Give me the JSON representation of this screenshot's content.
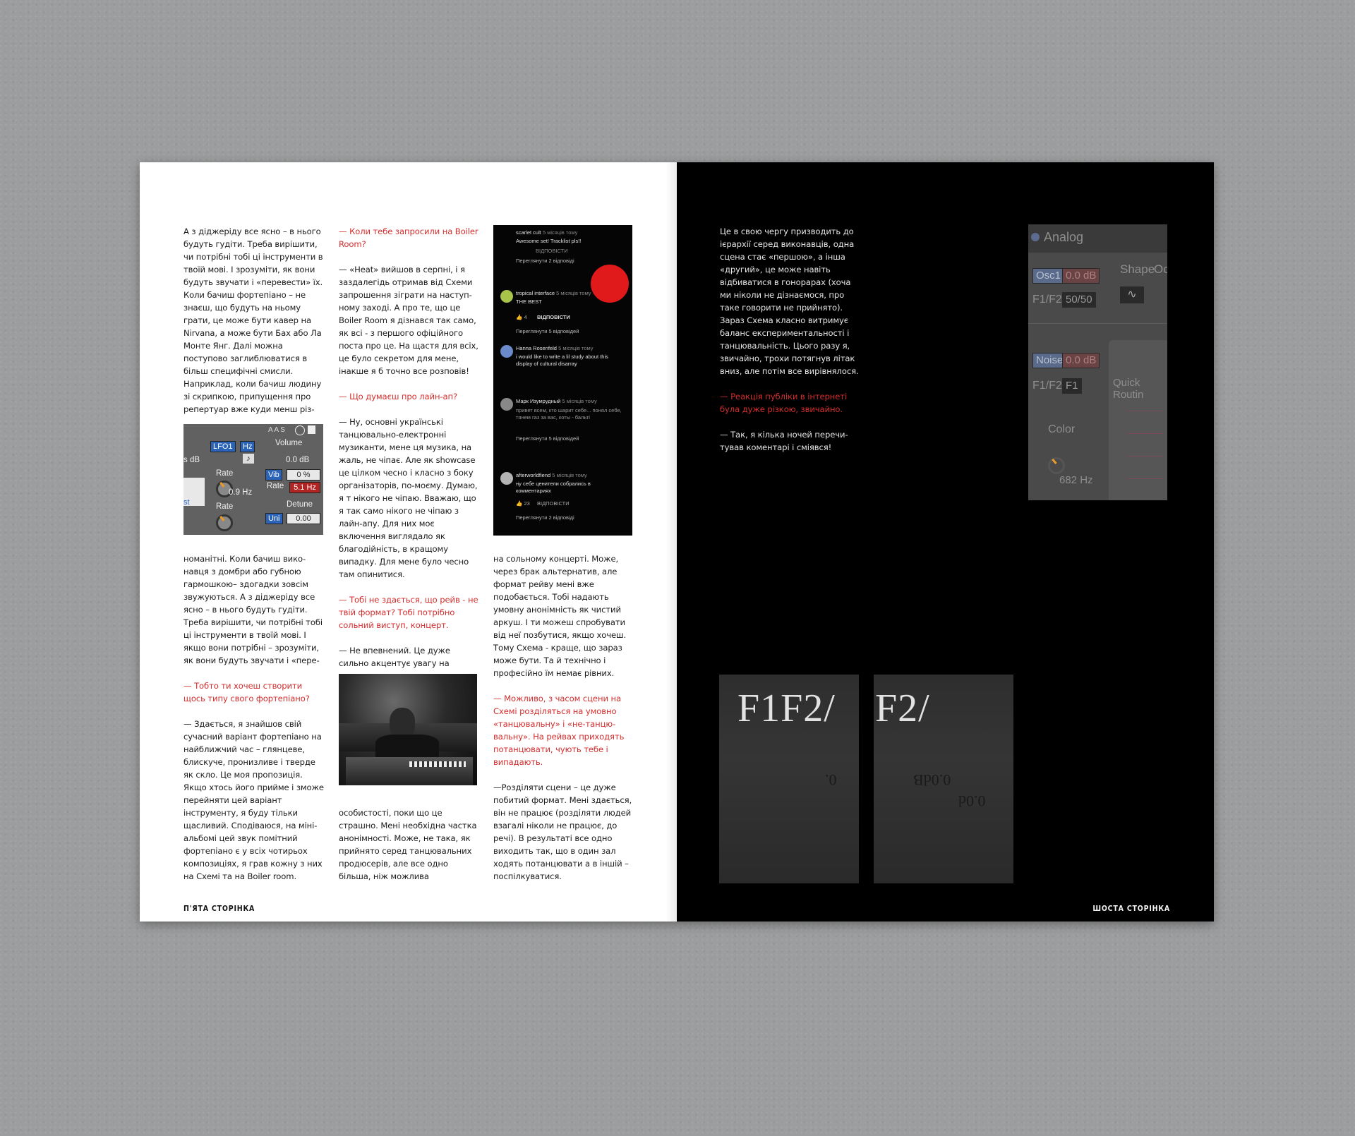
{
  "left_page": {
    "col1": {
      "top": [
        "А з діджеріду все ясно – в нього будуть гудіти. Треба вирі­шити, чи потрібні тобі ці інстру­менти в твоїй мові. І зрозуміти, як вони будуть звучати і «пе­ревести» їх. Коли бачиш фор­тепіано – не знаєш, що будуть на ньому грати, це може бути кавер на Nirvana, а може бути Бах або Ла Монте Янг.  Далі можна поступово заглиблюва­тися в більш специфічні смисли. Наприклад, коли бачиш людину зі скрипкою, припущення про репертуар вже куди менш різ-"
      ],
      "bottom_p1": "номанітні. Коли бачиш вико­навця з домбри або губною гармошкою– здогадки зовсім звужуються. А з діджеріду все ясно – в нього будуть гудіти. Треба вирішити, чи потрібні тобі ці інструменти в твоїй мові. І якщо вони потрібні – зрозуміти, як вони будуть звучати і «пере-",
      "question": "— Тобто ти хочеш створити щось типу свого  фортепіано?",
      "answer": "— Здається, я знайшов свій сучасний варіант фортепіано на найближчий час – глянцеве, блискуче, пронизливе і тверде як скло. Це моя пропозиція. Якщо хтось його прийме і зможе перейняти цей варіант інструменту, я буду тільки щасливий. Сподіваюся, на міні-альбомі цей звук помітний фортепіано є у всіх чотирьох композиціях, я грав кожну з них на Схемі та на Boiler room."
    },
    "col2": {
      "q1": "— Коли тебе запросили на Boiler Room?",
      "a1": "— «Heat» вийшов в серпні, і я заздалегідь отримав від Схеми запрошення зіграти на наступ­ному заході. А про те, що це Boiler Room я дізнався так само, як всі - з першого офіційного поста про це. На щастя для всіх, це було секретом для мене, інакше я б точно все розповів!",
      "q2": "— Що думаєш про лайн-ап?",
      "a2": "— Ну, основні українські танцювально-електронні музиканти, мене ця музика, на жаль, не чіпає. Але як showcase це цілком чесно і класно з боку організаторів, по-моєму. Думаю, я т нікого не чіпаю. Вважаю, що я так само нікого не чіпаю з лайн-апу. Для них моє включення виглядало як благодійність, в кращому випадку. Для мене було чесно там опинитися.",
      "q3": "— Тобі не здається, що рейв - не твій формат? Тобі потрібно сольний виступ, концерт.",
      "a3": "— Не впевнений. Це дуже сильно акцентує увагу на",
      "a3_cont": "особистості, поки що це страшно. Мені необхідна частка анонімності. Може, не така, як прийнято серед танцювальних продюсерів, але все одно більша, ніж можлива"
    },
    "col3": {
      "a_cont": "на сольному концерті.  Може, через брак альтернатив, але формат рейву мені вже подобається. Тобі надають умовну анонімність як чистий аркуш. І ти можеш спробувати від неї позбутися, якщо хочеш. Тому Схема - краще, що зараз може бути. Та й технічно і професійно їм немає рівних.",
      "q4": "— Можливо, з часом сцени на Схемі розділяться на умовно «танцювальну» і «не-танцю­вальну». На рейвах приходять потанцювати, чують тебе і випадають.",
      "a4": "—Розділяти сцени – це дуже побитий формат. Мені зда­ється, він не працює (розділяти людей взагалі ніколи не працює, до речі).  В результаті все одно виходить так, що в один зал ходять потанцювати а в іншій – поспілкуватися."
    },
    "folio": "П'ЯТА СТОРІНКА",
    "synth": {
      "lfo": "LFO1",
      "hz": "Hz",
      "volume": "Volume",
      "vol_val": "0.0 dB",
      "db": "s dB",
      "rate": "Rate",
      "rate_val": "0.9 Hz",
      "vib": "Vib",
      "vib_val": "0 %",
      "rate2": "Rate",
      "rate2_val": "5.1 Hz",
      "rate3": "Rate",
      "detune": "Detune",
      "uni": "Uni",
      "uni_val": "0.00",
      "st": "st",
      "header": "A A S"
    },
    "comments": [
      {
        "user": "scarlet cult",
        "time": "5 місяців тому",
        "text": "Awesome set! Tracklist pls!!",
        "reply": "ВІДПОВІСТИ",
        "more": "Переглянути 2 відповіді"
      },
      {
        "user": "tropical interface",
        "time": "5 місяців тому",
        "text": "THE BEST",
        "likes": "4",
        "reply": "ВІДПОВІСТИ",
        "more": "Переглянути 5 відповідей"
      },
      {
        "user": "Hanna Rosenfeld",
        "time": "5 місяців тому",
        "text": "i would like to write a lil study about this display of cultural disarray"
      },
      {
        "user": "Марк Изумрудный",
        "time": "5 місяців тому",
        "text": "привет всем, кто шарит себе... понял себе, тянем газ за вас, коты - бальті",
        "more": "Переглянути 5 відповідей"
      },
      {
        "user": "afterworldfiend",
        "time": "5 місяців тому",
        "text": "ну себе ценители собрались в комментариях",
        "likes": "23",
        "reply": "ВІДПОВІСТИ",
        "more": "Переглянути 2 відповіді"
      }
    ]
  },
  "right_page": {
    "col1": {
      "p1": "Це в свою чергу призводить до ієрархії серед виконавців, одна сцена стає «першою», а інша «другий», це може навіть відбиватися в гонорарах (хоча ми ніколи не дізнаємося, про таке говорити не прийнято). Зараз Схема класно витримує баланс експериментальності і танцювальність. Цього разу я, звичайно, трохи потягнув літак вниз, але потім все вирівнялося.",
      "q": "— Реакція публіки в інтернеті була дуже різкою, звичайно.",
      "a": "— Так, я кілька ночей перечи­тував коментарі і сміявся!"
    },
    "analog": {
      "title": "Analog",
      "shape": "Shape",
      "octave": "Octa",
      "osc1": "Osc1",
      "osc_val": "0.0 dB",
      "f1f2": "F1/F2",
      "ratio": "50/50",
      "noise": "Noise",
      "noise_val": "0.0 dB",
      "f1f2b": "F1/F2",
      "f1": "F1",
      "quick": "Quick Routin",
      "color": "Color",
      "color_val": "682 Hz"
    },
    "f_images": [
      {
        "big": "F1F2/",
        "small1": "0.",
        "small2": "0.0dB"
      },
      {
        "big": "F2/",
        "small1": "0.0dB",
        "small2": "0.0d"
      }
    ],
    "folio": "ШОСТА СТОРІНКА"
  },
  "colors": {
    "accent_red": "#d42d2d",
    "paper": "#ffffff",
    "dark_page": "#000000",
    "background": "#9c9d9e"
  }
}
